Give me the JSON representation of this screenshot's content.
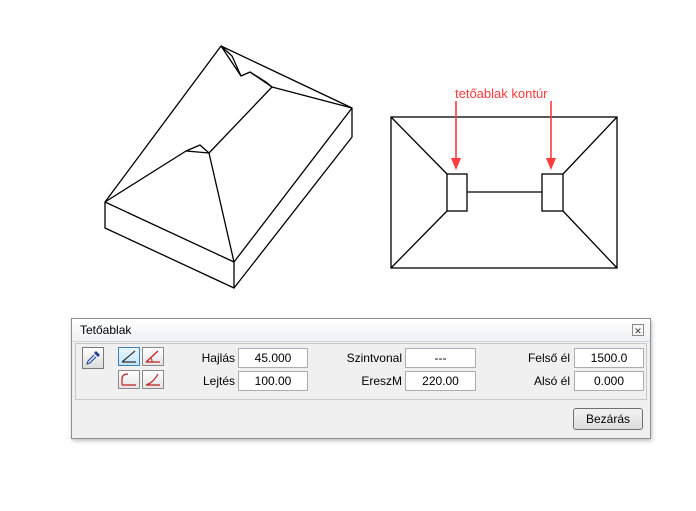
{
  "annotation": {
    "label": "tetőablak kontúr",
    "color": "#ff3b3b"
  },
  "dialog": {
    "title": "Tetőablak",
    "close_icon": "close-icon",
    "fields": {
      "hajlas": {
        "label": "Hajlás",
        "value": "45.000"
      },
      "lejtes": {
        "label": "Lejtés",
        "value": "100.00"
      },
      "szintvonal": {
        "label": "Szintvonal",
        "value": "---"
      },
      "ereszm": {
        "label": "EreszM",
        "value": "220.00"
      },
      "felso_el": {
        "label": "Felső él",
        "value": "1500.0"
      },
      "also_el": {
        "label": "Alsó él",
        "value": "0.000"
      }
    },
    "close_button": "Bezárás"
  }
}
